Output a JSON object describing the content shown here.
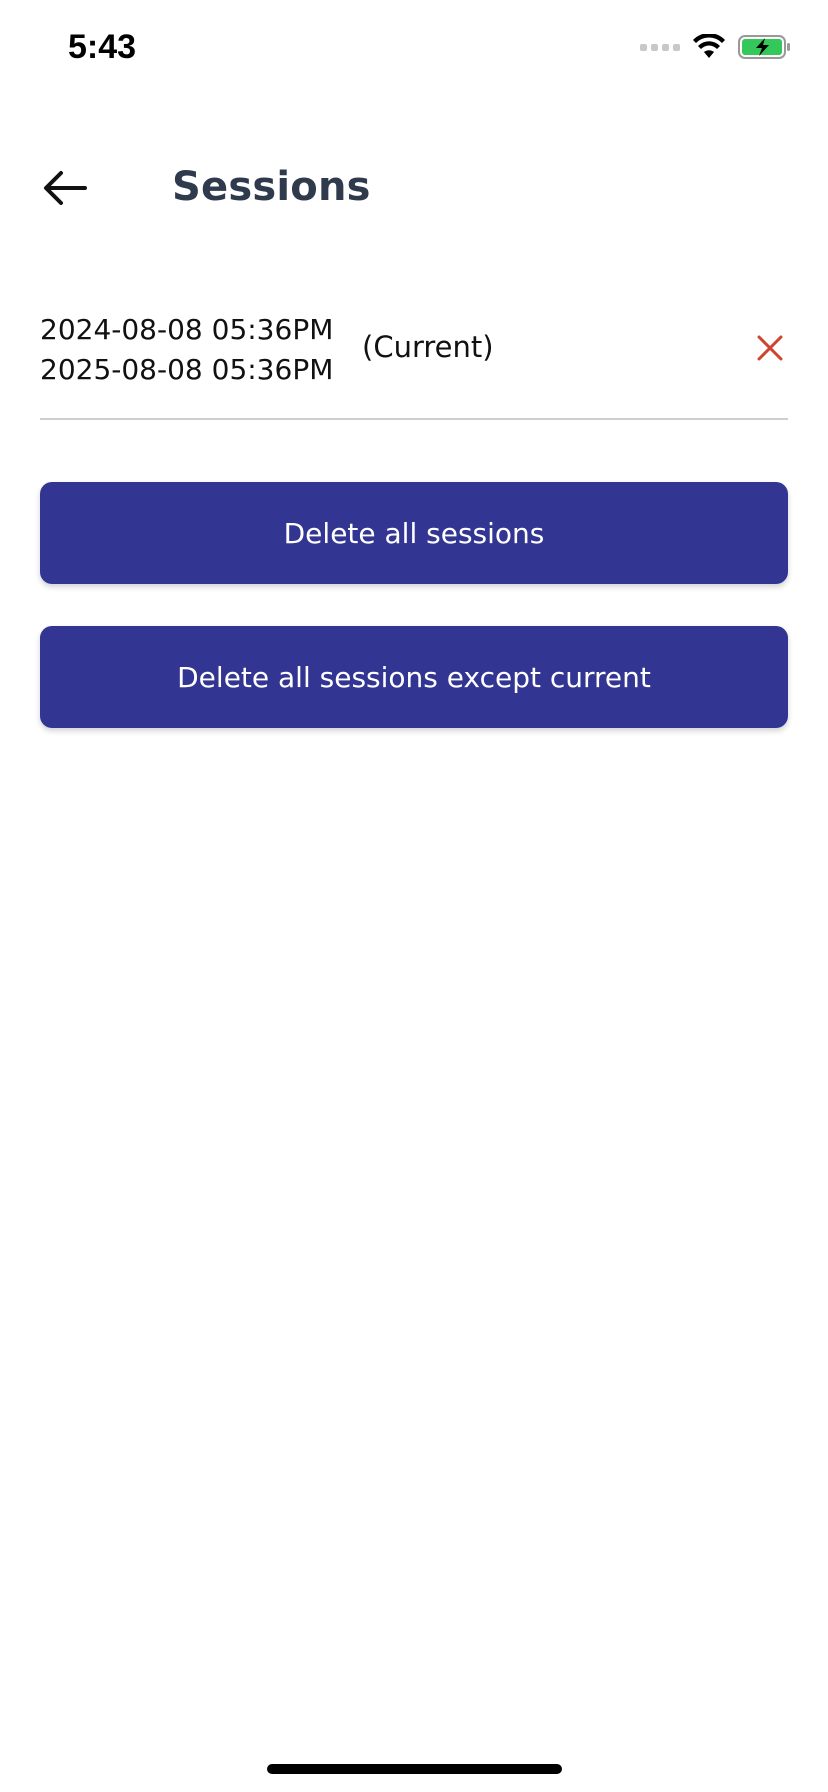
{
  "status_bar": {
    "time": "5:43",
    "icons": [
      "signal-dots-icon",
      "wifi-icon",
      "battery-charging-icon"
    ],
    "battery_color": "#34c759"
  },
  "header": {
    "back_icon": "arrow-left-icon",
    "title": "Sessions"
  },
  "sessions": [
    {
      "start": "2024-08-08 05:36PM",
      "end": "2025-08-08 05:36PM",
      "label": "(Current)",
      "delete_icon": "close-icon",
      "delete_color": "#d0432e"
    }
  ],
  "actions": {
    "delete_all_label": "Delete all sessions",
    "delete_except_current_label": "Delete all sessions except current",
    "button_color": "#333592"
  }
}
